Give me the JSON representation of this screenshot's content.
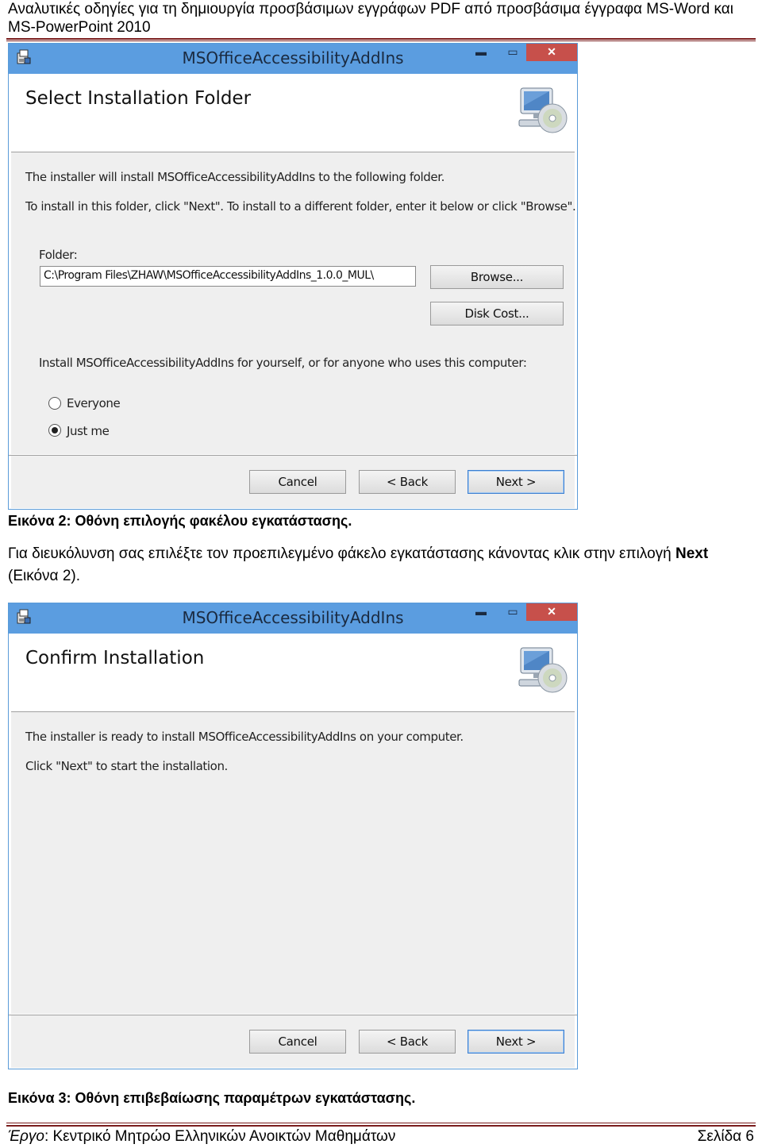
{
  "header": {
    "title": "Αναλυτικές οδηγίες για τη δημιουργία προσβάσιμων εγγράφων PDF από προσβάσιμα έγγραφα MS-Word και MS-PowerPoint 2010"
  },
  "dialog1": {
    "window_title": "MSOfficeAccessibilityAddIns",
    "heading": "Select Installation Folder",
    "line1": "The installer will install MSOfficeAccessibilityAddIns to the following folder.",
    "line2": "To install in this folder, click \"Next\". To install to a different folder, enter it below or click \"Browse\".",
    "folder_label": "Folder:",
    "folder_value": "C:\\Program Files\\ZHAW\\MSOfficeAccessibilityAddIns_1.0.0_MUL\\",
    "browse": "Browse...",
    "disk_cost": "Disk Cost...",
    "scope_text": "Install MSOfficeAccessibilityAddIns for yourself, or for anyone who uses this computer:",
    "radio_everyone": "Everyone",
    "radio_justme": "Just me",
    "selected_scope": "Just me",
    "cancel": "Cancel",
    "back": "< Back",
    "next": "Next >"
  },
  "caption1": "Εικόνα 2: Οθόνη επιλογής φακέλου εγκατάστασης.",
  "paragraph": {
    "text": "Για διευκόλυνση σας επιλέξτε τον προεπιλεγμένο φάκελο εγκατάστασης κάνοντας κλικ στην επιλογή ",
    "bold": "Next",
    "tail": " (Εικόνα 2)."
  },
  "dialog2": {
    "window_title": "MSOfficeAccessibilityAddIns",
    "heading": "Confirm Installation",
    "line1": "The installer is ready to install MSOfficeAccessibilityAddIns on your computer.",
    "line2": "Click \"Next\" to start the installation.",
    "cancel": "Cancel",
    "back": "< Back",
    "next": "Next >"
  },
  "caption2": "Εικόνα 3: Οθόνη επιβεβαίωσης παραμέτρων εγκατάστασης.",
  "footer": {
    "left_label": "Έργο",
    "left_text": ": Κεντρικό Μητρώο Ελληνικών Ανοικτών Μαθημάτων",
    "right": "Σελίδα 6"
  },
  "colors": {
    "titlebar": "#5b9de0",
    "close_button": "#c7504b",
    "rule": "#7a1c1c"
  },
  "icons": [
    "installer-app-icon",
    "computer-cd-icon",
    "close-icon",
    "minimize-icon",
    "maximize-icon"
  ]
}
